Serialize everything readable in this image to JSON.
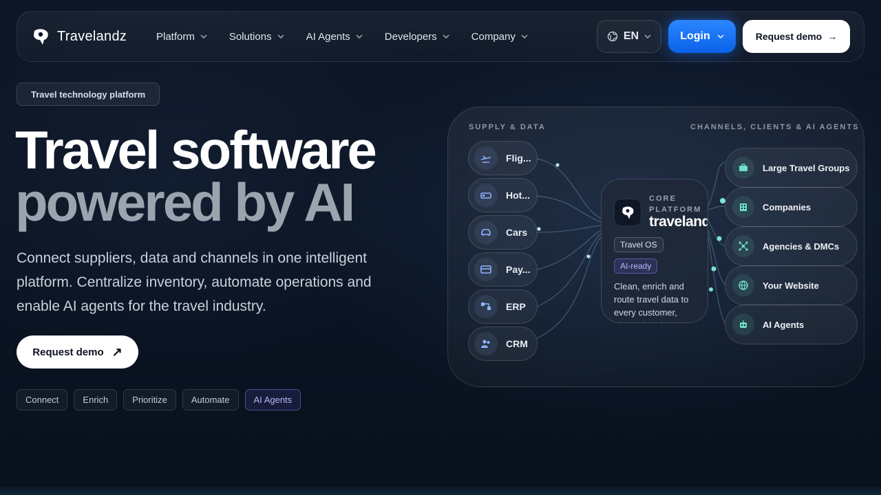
{
  "brand": {
    "name": "Travelandz"
  },
  "nav": {
    "items": [
      {
        "label": "Platform"
      },
      {
        "label": "Solutions"
      },
      {
        "label": "AI Agents"
      },
      {
        "label": "Developers"
      },
      {
        "label": "Company"
      }
    ],
    "language": "EN",
    "login_label": "Login",
    "demo_label": "Request demo",
    "demo_arrow": "→"
  },
  "hero": {
    "tag": "Travel technology platform",
    "headline_line1": "Travel software",
    "headline_line2": "powered by AI",
    "lead": "Connect suppliers, data and channels in one intelligent platform. Centralize inventory, automate operations and enable AI agents for the travel industry.",
    "cta_label": "Request demo",
    "cta_icon": "↗",
    "chips": [
      {
        "label": "Connect"
      },
      {
        "label": "Enrich"
      },
      {
        "label": "Prioritize"
      },
      {
        "label": "Automate"
      },
      {
        "label": "AI Agents"
      }
    ]
  },
  "diagram": {
    "supply_title": "SUPPLY & DATA",
    "channels_title": "CHANNELS, CLIENTS & AI AGENTS",
    "sources": [
      {
        "label": "Flig...",
        "icon": "plane-icon"
      },
      {
        "label": "Hot...",
        "icon": "bed-icon"
      },
      {
        "label": "Cars",
        "icon": "car-icon"
      },
      {
        "label": "Pay...",
        "icon": "card-icon"
      },
      {
        "label": "ERP",
        "icon": "erp-icon"
      },
      {
        "label": "CRM",
        "icon": "users-icon"
      }
    ],
    "core": {
      "label": "CORE PLATFORM",
      "brand": "travelandz",
      "pill_os": "Travel OS",
      "pill_ai": "AI-ready",
      "description": "Clean, enrich and route travel data to every customer, channel and AI"
    },
    "destinations": [
      {
        "label": "Large Travel Groups",
        "icon": "briefcase-icon"
      },
      {
        "label": "Companies",
        "icon": "building-icon"
      },
      {
        "label": "Agencies & DMCs",
        "icon": "network-icon"
      },
      {
        "label": "Your Website",
        "icon": "globe-icon"
      },
      {
        "label": "AI Agents",
        "icon": "robot-icon"
      }
    ]
  },
  "colors": {
    "background": "#0b1220",
    "accent_blue": "#1a73ff",
    "ai_purple": "#b9b5ff",
    "teal": "#6fe0c8"
  }
}
